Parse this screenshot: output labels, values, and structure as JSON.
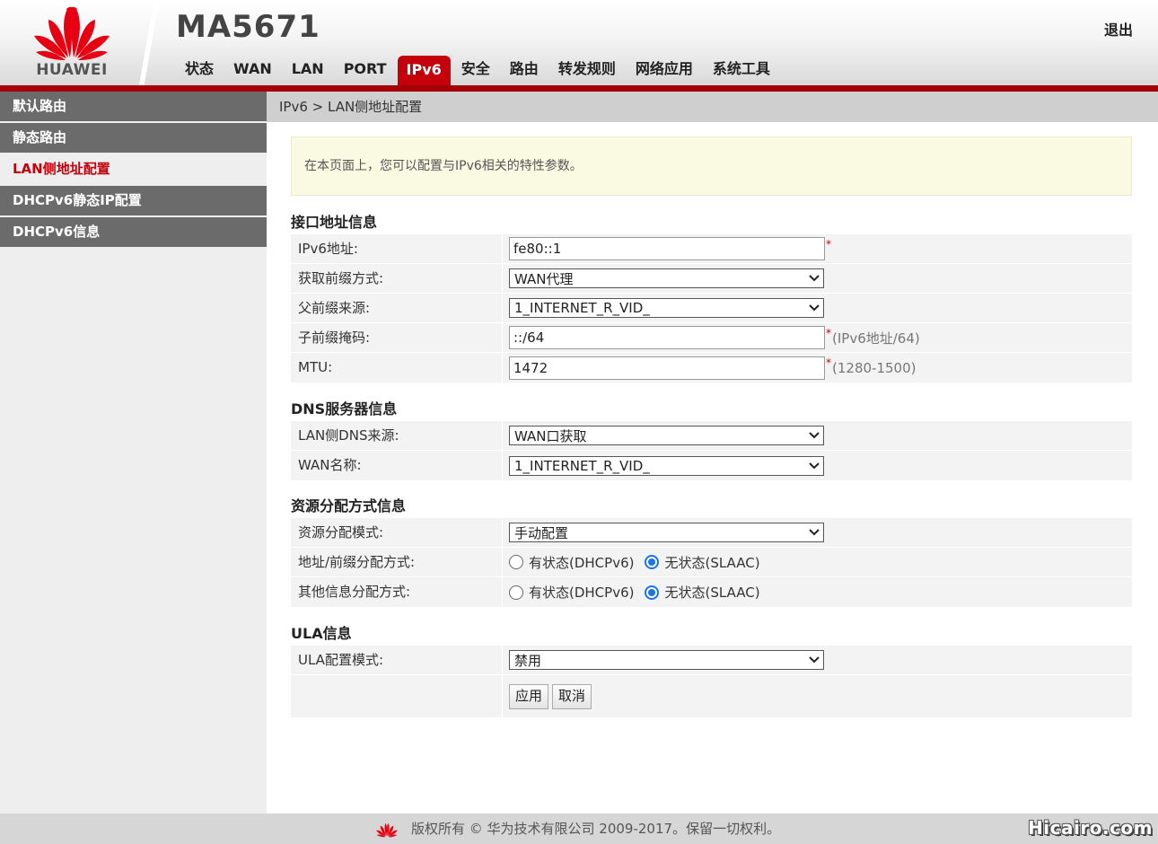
{
  "header": {
    "brand": "HUAWEI",
    "device_title": "MA5671",
    "logout": "退出",
    "nav": [
      "状态",
      "WAN",
      "LAN",
      "PORT",
      "IPv6",
      "安全",
      "路由",
      "转发规则",
      "网络应用",
      "系统工具"
    ],
    "active_nav": "IPv6"
  },
  "sidebar": {
    "items": [
      "默认路由",
      "静态路由",
      "LAN侧地址配置",
      "DHCPv6静态IP配置",
      "DHCPv6信息"
    ],
    "active": "LAN侧地址配置"
  },
  "breadcrumb": "IPv6 > LAN侧地址配置",
  "notice": "在本页面上，您可以配置与IPv6相关的特性参数。",
  "sections": {
    "interface": {
      "title": "接口地址信息",
      "ipv6_label": "IPv6地址:",
      "ipv6_value": "fe80::1",
      "prefix_mode_label": "获取前缀方式:",
      "prefix_mode_value": "WAN代理",
      "parent_prefix_label": "父前缀来源:",
      "parent_prefix_value": "1_INTERNET_R_VID_",
      "subnet_mask_label": "子前缀掩码:",
      "subnet_mask_value": "::/64",
      "subnet_mask_hint": "(IPv6地址/64)",
      "mtu_label": "MTU:",
      "mtu_value": "1472",
      "mtu_hint": "(1280-1500)"
    },
    "dns": {
      "title": "DNS服务器信息",
      "source_label": "LAN侧DNS来源:",
      "source_value": "WAN口获取",
      "wan_name_label": "WAN名称:",
      "wan_name_value": "1_INTERNET_R_VID_"
    },
    "resource": {
      "title": "资源分配方式信息",
      "mode_label": "资源分配模式:",
      "mode_value": "手动配置",
      "addr_label": "地址/前缀分配方式:",
      "other_label": "其他信息分配方式:",
      "stateful": "有状态(DHCPv6)",
      "stateless": "无状态(SLAAC)",
      "addr_selected": "stateless",
      "other_selected": "stateless"
    },
    "ula": {
      "title": "ULA信息",
      "mode_label": "ULA配置模式:",
      "mode_value": "禁用"
    }
  },
  "buttons": {
    "apply": "应用",
    "cancel": "取消"
  },
  "footer": {
    "copyright": "版权所有 © 华为技术有限公司 2009-2017。保留一切权利。",
    "watermark": "Hicairo.com"
  },
  "required_mark": "*",
  "colors": {
    "brand_red": "#c3000b",
    "accent_blue": "#1a73e8"
  }
}
